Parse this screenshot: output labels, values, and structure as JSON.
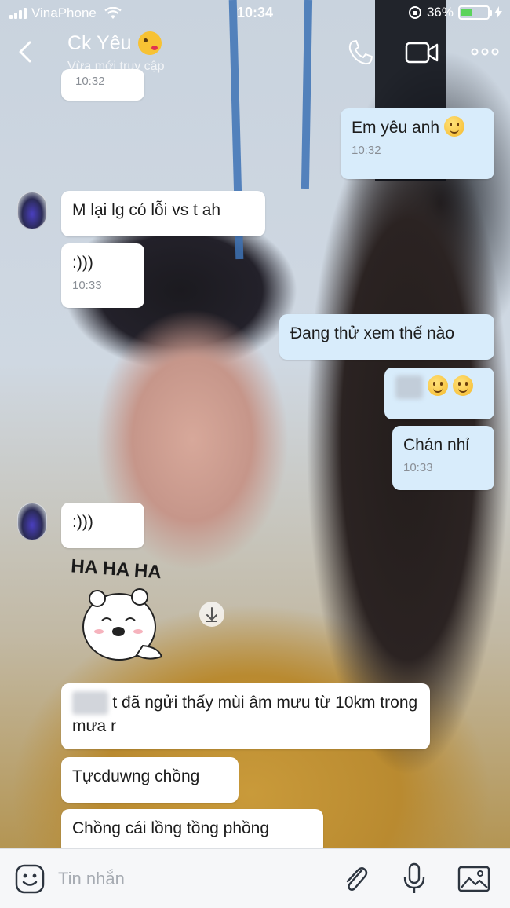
{
  "status_bar": {
    "carrier": "VinaPhone",
    "time": "10:34",
    "battery": "36%"
  },
  "header": {
    "contact_name": "Ck Yêu",
    "contact_status": "Vừa mới truy cập"
  },
  "messages": [
    {
      "side": "left",
      "time": "10:32"
    },
    {
      "side": "right",
      "text": "Em yêu anh",
      "emoji": "smiley",
      "time": "10:32"
    },
    {
      "side": "left",
      "text": "M lại lg có lỗi vs t ah"
    },
    {
      "side": "left",
      "text": ":)))",
      "time": "10:33"
    },
    {
      "side": "right",
      "text": "Đang thử xem thế nào"
    },
    {
      "side": "right",
      "text": "",
      "emoji": "smiley x2"
    },
    {
      "side": "right",
      "text": "Chán nhỉ",
      "time": "10:33"
    },
    {
      "side": "left",
      "text": ":)))"
    },
    {
      "side": "left",
      "sticker_text": "HA HA HA"
    },
    {
      "side": "left",
      "text": "t đã ngửi thấy mùi âm mưu từ 10km trong mưa r"
    },
    {
      "side": "left",
      "text": "Tựcduwng chồng"
    },
    {
      "side": "left",
      "text": "Chồng cái lồng tồng phồng"
    }
  ],
  "input": {
    "placeholder": "Tin nhắn"
  },
  "colors": {
    "my_bubble": "#d8ecfb",
    "their_bubble": "#ffffff",
    "accent": "#2a8cf0"
  }
}
